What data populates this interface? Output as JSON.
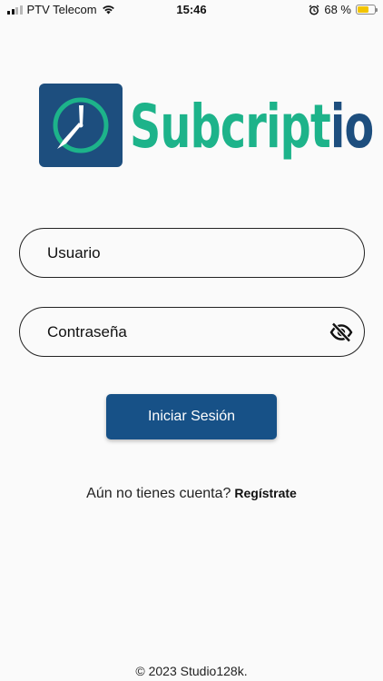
{
  "status_bar": {
    "carrier": "PTV Telecom",
    "time": "15:46",
    "battery_percent": "68 %",
    "battery_level": 0.68,
    "icons": [
      "signal-icon",
      "wifi-icon",
      "alarm-icon",
      "battery-icon"
    ]
  },
  "logo": {
    "text_main": "Subcript",
    "text_accent": "io",
    "icon": "clock-icon",
    "colors": {
      "primary": "#1d4e7e",
      "accent": "#1db38a"
    }
  },
  "form": {
    "username_placeholder": "Usuario",
    "username_value": "",
    "password_placeholder": "Contraseña",
    "password_value": "",
    "password_toggle_icon": "eye-off-icon",
    "login_label": "Iniciar Sesión",
    "login_color": "#175187"
  },
  "signup": {
    "prompt": "Aún no tienes cuenta?",
    "link": "Regístrate"
  },
  "footer": {
    "copyright": "© 2023 Studio128k."
  }
}
